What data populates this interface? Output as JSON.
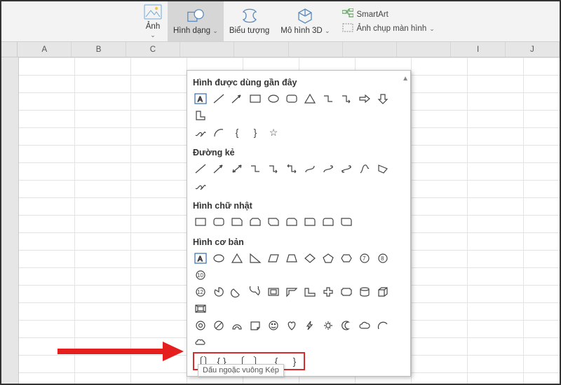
{
  "ribbon": {
    "images": {
      "label": "Ảnh"
    },
    "shapes": {
      "label": "Hình dạng"
    },
    "icons": {
      "label": "Biểu tượng"
    },
    "models": {
      "label": "Mô hình 3D"
    },
    "smartart": {
      "label": "SmartArt"
    },
    "screenshot": {
      "label": "Ảnh chụp màn hình"
    }
  },
  "columns": [
    "A",
    "B",
    "C",
    "",
    "",
    "",
    "",
    "",
    "I",
    "J"
  ],
  "shapes_menu": {
    "recent": {
      "title": "Hình được dùng gần đây"
    },
    "lines": {
      "title": "Đường kẻ"
    },
    "rects": {
      "title": "Hình chữ nhật"
    },
    "basic": {
      "title": "Hình cơ bản"
    }
  },
  "tooltip": "Dấu ngoặc vuông Kép"
}
